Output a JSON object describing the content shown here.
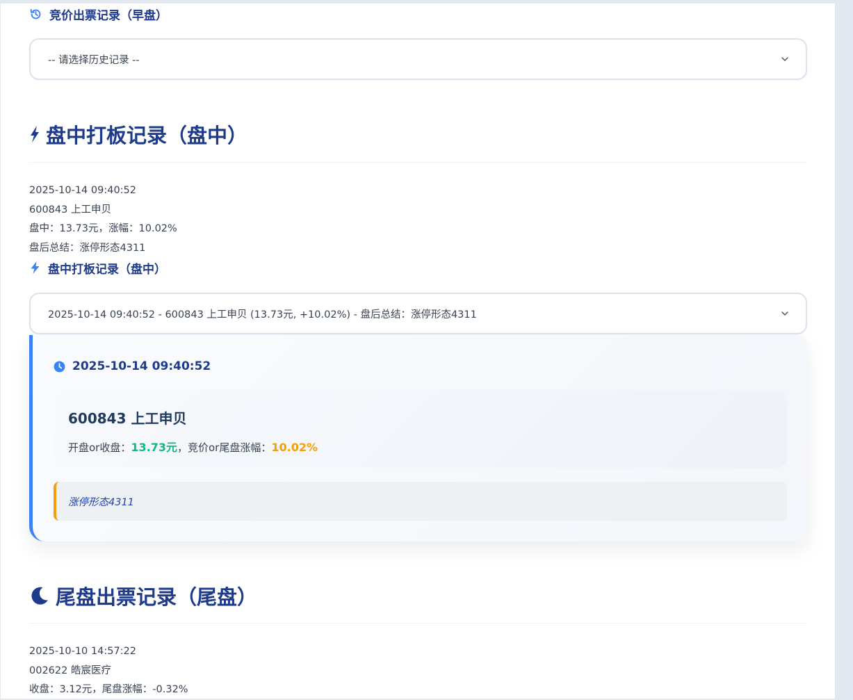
{
  "auction_section": {
    "heading": "竞价出票记录（早盘）",
    "select_placeholder": "-- 请选择历史记录 --"
  },
  "intraday_section": {
    "heading": "盘中打板记录（盘中）",
    "lines": [
      "2025-10-14 09:40:52",
      "600843 上工申贝",
      "盘中：13.73元，涨幅：10.02%",
      "盘后总结：涨停形态4311"
    ],
    "sub_heading": "盘中打板记录（盘中）",
    "select_value": "2025-10-14 09:40:52 - 600843 上工申贝 (13.73元, +10.02%) - 盘后总结：涨停形态4311",
    "card": {
      "time": "2025-10-14 09:40:52",
      "stock": "600843 上工申贝",
      "price_label": "开盘or收盘：",
      "price": "13.73元",
      "change_label": "，竞价or尾盘涨幅：",
      "change": "10.02%",
      "summary": "涨停形态4311"
    }
  },
  "closing_section": {
    "heading": "尾盘出票记录（尾盘）",
    "lines": [
      "2025-10-10 14:57:22",
      "002622 皓宸医疗",
      "收盘：3.12元，尾盘涨幅：-0.32%"
    ]
  },
  "colors": {
    "heading": "#1e3a8a",
    "accent_blue": "#3b82f6",
    "price_green": "#10b981",
    "change_orange": "#f59e0b"
  },
  "icons": {
    "auction": "history-icon",
    "intraday": "lightning-icon",
    "clock": "clock-icon",
    "closing": "moon-icon",
    "dropdown": "chevron-down-icon"
  }
}
